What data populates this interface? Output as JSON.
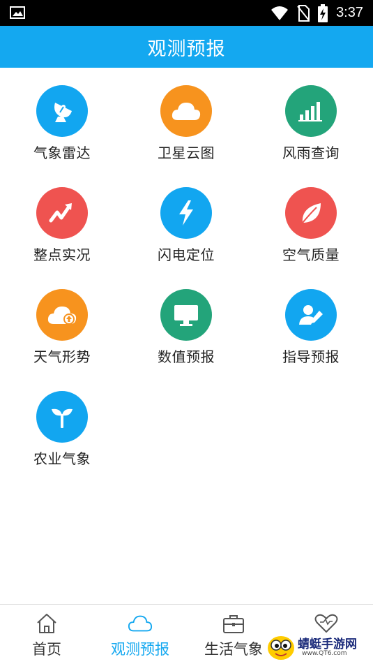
{
  "status_bar": {
    "time": "3:37",
    "icons": [
      "image-icon",
      "wifi-icon",
      "no-sim-icon",
      "battery-charging-icon"
    ]
  },
  "app_bar": {
    "title": "观测预报"
  },
  "grid": [
    {
      "label": "气象雷达",
      "icon": "radar-dish-icon",
      "color": "#12a6f0"
    },
    {
      "label": "卫星云图",
      "icon": "cloud-icon",
      "color": "#f7931e"
    },
    {
      "label": "风雨查询",
      "icon": "bar-chart-icon",
      "color": "#23a47a"
    },
    {
      "label": "整点实况",
      "icon": "trend-arrow-icon",
      "color": "#ef5350"
    },
    {
      "label": "闪电定位",
      "icon": "lightning-icon",
      "color": "#12a6f0"
    },
    {
      "label": "空气质量",
      "icon": "leaf-icon",
      "color": "#ef5350"
    },
    {
      "label": "天气形势",
      "icon": "cloud-upload-icon",
      "color": "#f7931e"
    },
    {
      "label": "数值预报",
      "icon": "monitor-icon",
      "color": "#23a47a"
    },
    {
      "label": "指导预报",
      "icon": "user-edit-icon",
      "color": "#12a6f0"
    },
    {
      "label": "农业气象",
      "icon": "sprout-icon",
      "color": "#12a6f0"
    }
  ],
  "tab_bar": {
    "active_color": "#14a8f0",
    "items": [
      {
        "label": "首页",
        "icon": "home-icon"
      },
      {
        "label": "观测预报",
        "icon": "cloud-outline-icon",
        "active": true
      },
      {
        "label": "生活气象",
        "icon": "briefcase-icon"
      },
      {
        "label": "",
        "icon": "heart-icon"
      }
    ]
  },
  "watermark": {
    "text": "蜻蜓手游网",
    "url": "www.QT6.com"
  }
}
